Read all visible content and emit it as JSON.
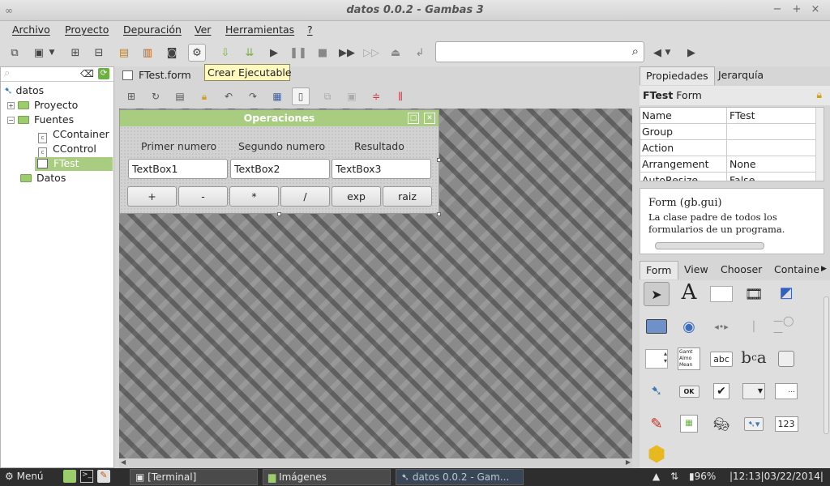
{
  "window": {
    "title": "datos 0.0.2 - Gambas 3",
    "minimize": "−",
    "maximize": "+",
    "close": "×"
  },
  "menu": [
    "Archivo",
    "Proyecto",
    "Depuración",
    "Ver",
    "Herramientas",
    "?"
  ],
  "tooltip": "Crear Ejecutable",
  "search": {
    "value": "",
    "placeholder": ""
  },
  "tree": {
    "root": "datos",
    "items": [
      {
        "label": "Proyecto"
      },
      {
        "label": "Fuentes"
      },
      {
        "label": "CContainer"
      },
      {
        "label": "CControl"
      },
      {
        "label": "FTest"
      },
      {
        "label": "Datos"
      }
    ],
    "class_icon_letter": "c"
  },
  "editor": {
    "tab": "FTest.form",
    "form": {
      "title": "Operaciones",
      "labels": [
        "Primer numero",
        "Segundo numero",
        "Resultado"
      ],
      "textboxes": [
        "TextBox1",
        "TextBox2",
        "TextBox3"
      ],
      "buttons": [
        "+",
        "-",
        "*",
        "/",
        "exp",
        "raiz"
      ]
    }
  },
  "properties": {
    "tabs": [
      "Propiedades",
      "Jerarquía"
    ],
    "object": "FTest",
    "class": "Form",
    "rows": [
      {
        "name": "Name",
        "value": "FTest"
      },
      {
        "name": "Group",
        "value": ""
      },
      {
        "name": "Action",
        "value": ""
      },
      {
        "name": "Arrangement",
        "value": "None"
      },
      {
        "name": "AutoResize",
        "value": "False"
      }
    ],
    "help_title": "Form (gb.gui)",
    "help_text": "La clase padre de todos los formularios de un programa."
  },
  "toolbox": {
    "tabs": [
      "Form",
      "View",
      "Chooser",
      "Containe"
    ],
    "items": {
      "abc": "abc",
      "ok": "OK",
      "dots": "...",
      "num": "123",
      "big_a": "A",
      "listbox": "Gamt Almo Mean"
    }
  },
  "taskbar": {
    "menu": "Menú",
    "tasks": [
      "[Terminal]",
      "Imágenes",
      "datos 0.0.2 - Gam..."
    ],
    "battery": "96%",
    "clock": "|12:13|03/22/2014|"
  }
}
